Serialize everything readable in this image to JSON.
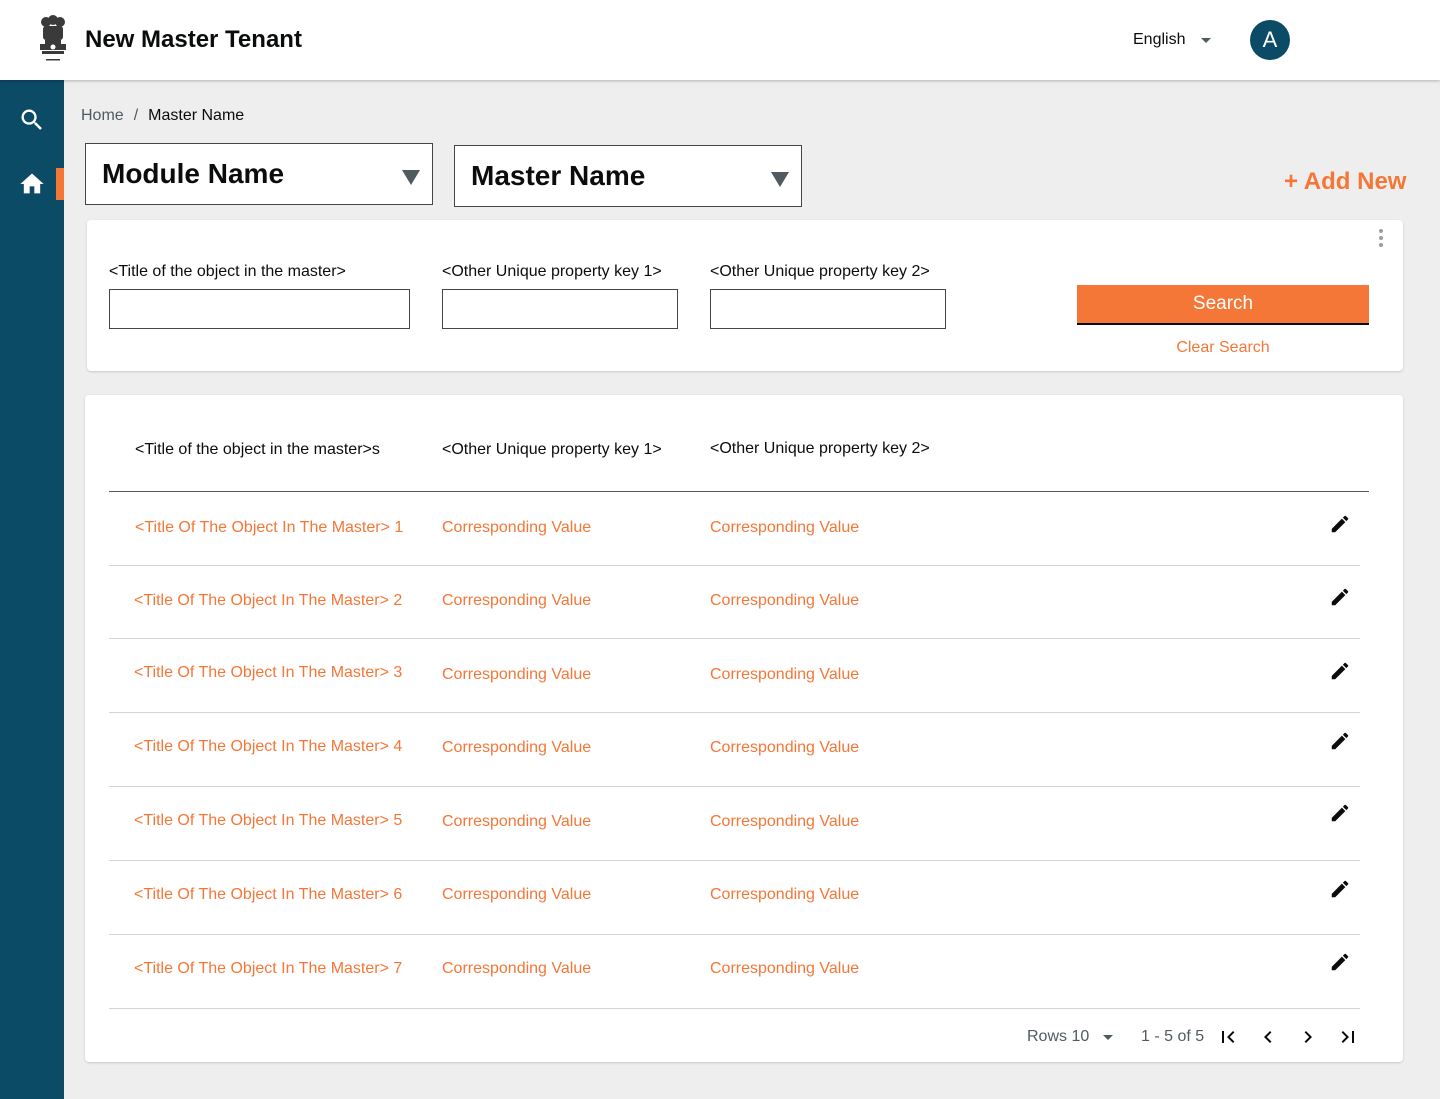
{
  "header": {
    "title": "New Master Tenant",
    "language": "English",
    "avatar_initial": "A"
  },
  "sidebar": {
    "items": [
      {
        "icon": "search-icon",
        "active": false
      },
      {
        "icon": "home-icon",
        "active": true
      }
    ]
  },
  "breadcrumb": {
    "home": "Home",
    "separator": "/",
    "current": "Master Name"
  },
  "filters": {
    "module_select": "Module Name",
    "master_select": "Master Name",
    "add_new": "+ Add New"
  },
  "search_card": {
    "fields": [
      {
        "label": "<Title of the object in the master>",
        "value": ""
      },
      {
        "label": "<Other Unique property key 1>",
        "value": ""
      },
      {
        "label": "<Other Unique property key 2>",
        "value": ""
      }
    ],
    "search_button": "Search",
    "clear_search": "Clear Search"
  },
  "table": {
    "headers": [
      "<Title of the object in the master>s",
      "<Other Unique property key 1>",
      "<Other Unique property key 2>"
    ],
    "rows": [
      [
        "<Title Of The Object In The Master> 1",
        "Corresponding Value",
        "Corresponding Value"
      ],
      [
        "<Title Of The Object In The Master> 2",
        "Corresponding Value",
        "Corresponding Value"
      ],
      [
        "<Title Of The Object In The Master> 3",
        "Corresponding Value",
        "Corresponding Value"
      ],
      [
        "<Title Of The Object In The Master> 4",
        "Corresponding Value",
        "Corresponding Value"
      ],
      [
        "<Title Of The Object In The Master> 5",
        "Corresponding Value",
        "Corresponding Value"
      ],
      [
        "<Title Of The Object In The Master> 6",
        "Corresponding Value",
        "Corresponding Value"
      ],
      [
        "<Title Of The Object In The Master> 7",
        "Corresponding Value",
        "Corresponding Value"
      ]
    ]
  },
  "pagination": {
    "rows_label": "Rows 10",
    "range": "1 - 5 of 5"
  },
  "colors": {
    "primary": "#f47738",
    "sidebar": "#0b4b66",
    "text": "#0b0c0c",
    "muted": "#505a5f"
  }
}
